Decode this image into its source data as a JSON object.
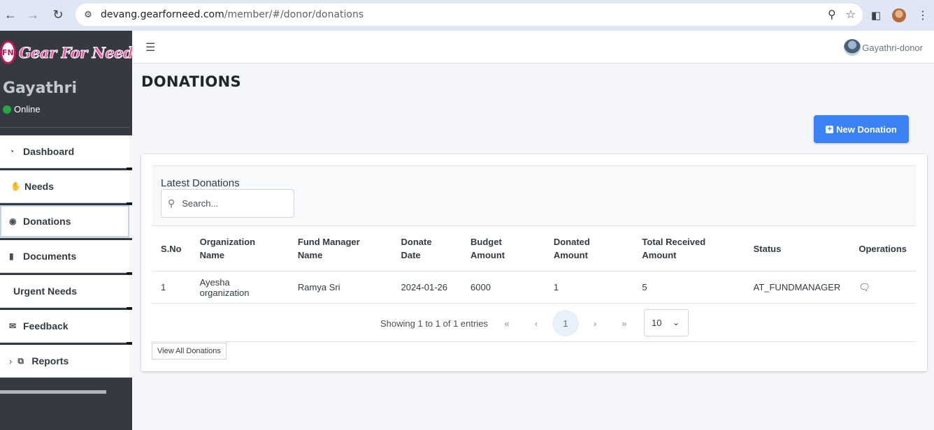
{
  "browser": {
    "url_host": "devang.gearforneed.com",
    "url_path": "/member/#/donor/donations"
  },
  "sidebar": {
    "logo_text": "Gear For Need",
    "logo_mark": "FN",
    "user_name": "Gayathri",
    "status": "Online",
    "items": [
      {
        "label": "Dashboard",
        "icon": "chart-pie-icon"
      },
      {
        "label": "Needs",
        "icon": "hand-holding-icon"
      },
      {
        "label": "Donations",
        "icon": "donate-icon"
      },
      {
        "label": "Documents",
        "icon": "file-icon"
      },
      {
        "label": "Urgent Needs",
        "icon": ""
      },
      {
        "label": "Feedback",
        "icon": "envelope-icon"
      },
      {
        "label": "Reports",
        "icon": "copy-icon"
      }
    ]
  },
  "topbar": {
    "user_label": "Gayathri-donor"
  },
  "page": {
    "title": "DONATIONS",
    "new_button": "New Donation"
  },
  "card": {
    "title": "Latest Donations",
    "search_placeholder": "Search...",
    "columns": [
      "S.No",
      "Organization Name",
      "Fund Manager Name",
      "Donate Date",
      "Budget Amount",
      "Donated Amount",
      "Total Received Amount",
      "Status",
      "Operations"
    ],
    "rows": [
      {
        "sno": "1",
        "org": "Ayesha organization",
        "manager": "Ramya Sri",
        "date": "2024-01-26",
        "budget": "6000",
        "donated": "1",
        "received": "5",
        "status": "AT_FUNDMANAGER"
      }
    ],
    "pagination": {
      "showing": "Showing 1 to 1 of 1 entries",
      "first": "«",
      "prev": "‹",
      "current": "1",
      "next": "›",
      "last": "»",
      "page_size": "10"
    },
    "view_all": "View All Donations"
  }
}
